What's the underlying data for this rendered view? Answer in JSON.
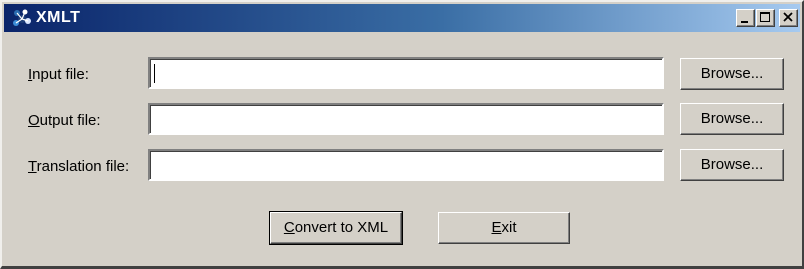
{
  "window": {
    "title": "XMLT",
    "app_icon": "xmlt-app-icon",
    "caption_buttons": [
      "minimize-icon",
      "maximize-icon",
      "close-icon"
    ]
  },
  "form": {
    "input_file": {
      "label_accel": "I",
      "label_rest": "nput file:",
      "value": ""
    },
    "output_file": {
      "label_accel": "O",
      "label_rest": "utput file:",
      "value": ""
    },
    "translation_file": {
      "label_accel": "T",
      "label_rest": "ranslation file:",
      "value": ""
    },
    "browse_label": "Browse..."
  },
  "actions": {
    "convert_accel": "C",
    "convert_rest": "onvert to XML",
    "exit_accel": "E",
    "exit_rest": "xit"
  }
}
